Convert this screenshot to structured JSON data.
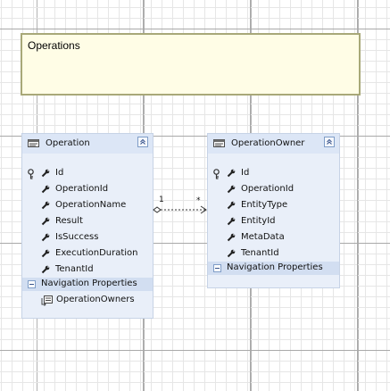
{
  "note": {
    "text": "Operations"
  },
  "entities": {
    "operation": {
      "title": "Operation",
      "properties": [
        {
          "name": "Id",
          "key": true
        },
        {
          "name": "OperationId",
          "key": false
        },
        {
          "name": "OperationName",
          "key": false
        },
        {
          "name": "Result",
          "key": false
        },
        {
          "name": "IsSuccess",
          "key": false
        },
        {
          "name": "ExecutionDuration",
          "key": false
        },
        {
          "name": "TenantId",
          "key": false
        }
      ],
      "navigation_header": "Navigation Properties",
      "navigation": [
        "OperationOwners"
      ]
    },
    "operation_owner": {
      "title": "OperationOwner",
      "properties": [
        {
          "name": "Id",
          "key": true
        },
        {
          "name": "OperationId",
          "key": false
        },
        {
          "name": "EntityType",
          "key": false
        },
        {
          "name": "EntityId",
          "key": false
        },
        {
          "name": "MetaData",
          "key": false
        },
        {
          "name": "TenantId",
          "key": false
        }
      ],
      "navigation_header": "Navigation Properties",
      "navigation": []
    }
  },
  "association": {
    "source_multiplicity": "1",
    "target_multiplicity": "*"
  },
  "colors": {
    "entity_background": "#e9eff9",
    "entity_header": "#dce6f6",
    "note_background": "#fffde6",
    "note_border": "#a8a878"
  }
}
